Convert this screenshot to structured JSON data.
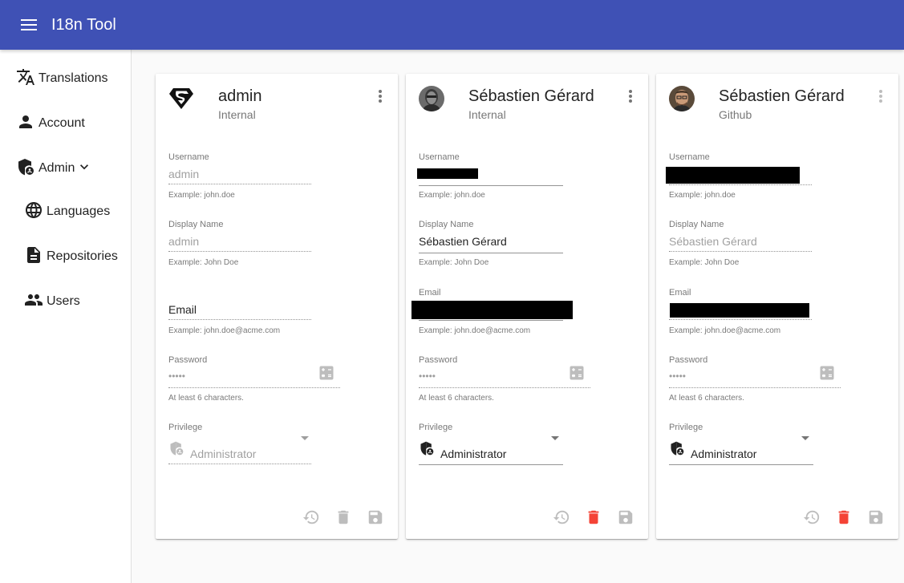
{
  "app": {
    "title": "I18n Tool"
  },
  "sidebar": {
    "items": [
      {
        "label": "Translations",
        "icon": "translate-icon"
      },
      {
        "label": "Account",
        "icon": "person-icon"
      },
      {
        "label": "Admin",
        "icon": "admin-shield-icon"
      },
      {
        "label": "Languages",
        "icon": "globe-icon"
      },
      {
        "label": "Repositories",
        "icon": "document-icon"
      },
      {
        "label": "Users",
        "icon": "people-icon"
      }
    ]
  },
  "cards": [
    {
      "name": "admin",
      "provider": "Internal",
      "avatar": "superman-logo",
      "username_label": "Username",
      "username_value": "admin",
      "username_help": "Example: john.doe",
      "display_label": "Display Name",
      "display_value": "admin",
      "display_help": "Example: John Doe",
      "email_label": "Email",
      "email_help": "Example: john.doe@acme.com",
      "password_label": "Password",
      "password_value": "•••••",
      "password_help": "At least 6 characters.",
      "privilege_label": "Privilege",
      "privilege_value": "Administrator"
    },
    {
      "name": "Sébastien Gérard",
      "provider": "Internal",
      "avatar": "user-photo",
      "username_label": "Username",
      "username_help": "Example: john.doe",
      "display_label": "Display Name",
      "display_value": "Sébastien Gérard",
      "display_help": "Example: John Doe",
      "email_label": "Email",
      "email_help": "Example: john.doe@acme.com",
      "password_label": "Password",
      "password_value": "•••••",
      "password_help": "At least 6 characters.",
      "privilege_label": "Privilege",
      "privilege_value": "Administrator"
    },
    {
      "name": "Sébastien Gérard",
      "provider": "Github",
      "avatar": "user-photo",
      "username_label": "Username",
      "username_help": "Example: john.doe",
      "display_label": "Display Name",
      "display_value": "Sébastien Gérard",
      "display_help": "Example: John Doe",
      "email_label": "Email",
      "email_help": "Example: john.doe@acme.com",
      "password_label": "Password",
      "password_value": "•••••",
      "password_help": "At least 6 characters.",
      "privilege_label": "Privilege",
      "privilege_value": "Administrator"
    }
  ],
  "colors": {
    "appbar": "#3f51b5",
    "delete_active": "#f44336",
    "disabled": "#bdbdbd"
  }
}
